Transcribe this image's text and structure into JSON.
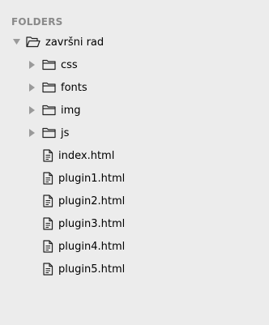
{
  "sidebar": {
    "header": "FOLDERS",
    "root": {
      "name": "završni rad",
      "icon": "folder-open-icon",
      "expanded": true
    },
    "folders": [
      {
        "name": "css",
        "icon": "folder-icon",
        "expanded": false
      },
      {
        "name": "fonts",
        "icon": "folder-icon",
        "expanded": false
      },
      {
        "name": "img",
        "icon": "folder-icon",
        "expanded": false
      },
      {
        "name": "js",
        "icon": "folder-icon",
        "expanded": false
      }
    ],
    "files": [
      {
        "name": "index.html",
        "icon": "file-icon"
      },
      {
        "name": "plugin1.html",
        "icon": "file-icon"
      },
      {
        "name": "plugin2.html",
        "icon": "file-icon"
      },
      {
        "name": "plugin3.html",
        "icon": "file-icon"
      },
      {
        "name": "plugin4.html",
        "icon": "file-icon"
      },
      {
        "name": "plugin5.html",
        "icon": "file-icon"
      }
    ]
  },
  "colors": {
    "background": "#ececec",
    "header_text": "#8a8a8a",
    "arrow": "#9a9a9a",
    "icon_stroke": "#222222",
    "text": "#000000"
  }
}
